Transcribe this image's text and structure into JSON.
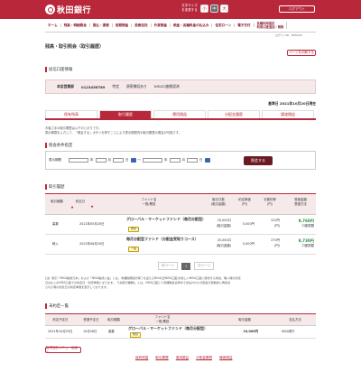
{
  "header": {
    "bank_name": "秋田銀行",
    "font_size_label": "文字サイズを変更する",
    "font_sizes": [
      "小",
      "中",
      "大"
    ],
    "logout_label": "ログアウト"
  },
  "nav": {
    "items": [
      "ホーム",
      "残高・明細照会",
      "振込・振替",
      "定期預金",
      "投資信託",
      "外貨預金",
      "税金・各種料金の払込み",
      "住宅ローン",
      "電子交付"
    ],
    "settings_label": "各種利用設定",
    "settings_sub": "利用口座追加・削除"
  },
  "user_id": "ログインID：RFR103",
  "page": {
    "title": "残高・取引照会（取引履歴）",
    "print_button": "ページを印刷する"
  },
  "section_titles": {
    "account": "投信口座情報",
    "filter": "照会条件指定",
    "history": "取引履歴",
    "orders": "未約定一覧"
  },
  "account": {
    "branch": "本店営業部",
    "number": "0123456789",
    "type": "特定",
    "withholding": "源泉徴収あり",
    "nisa": "NISA口座開設済"
  },
  "base_date": "基準日 2021年10月20日現在",
  "tabs": [
    "保有残高",
    "取引履歴",
    "運用損益",
    "分配金履歴",
    "譲渡損益"
  ],
  "note": {
    "line1": "お客さまの取引履歴は以下のとおりです。",
    "line2": "表示期間を入力して、「照会する」ボタンを押すことにより表示期間内の取引履歴の照会が可能です。"
  },
  "filter": {
    "label": "表示期間",
    "year": "年",
    "month": "月",
    "day": "日",
    "tilde": "～",
    "calendar": "カレンダー",
    "query_button": "照会する"
  },
  "history": {
    "headers": {
      "trade_type": "取引種類",
      "agreed_date": "約定日",
      "fund": "ファンド名",
      "fund_sub": "一般/累投",
      "amount": "取引口数",
      "amount_sub": "(取引金額)",
      "price": "約定単価",
      "price_sub": "(円)",
      "fee": "手数料等",
      "fee_sub": "(円)",
      "settlement": "受渡金額",
      "settlement_sub": "受渡方法",
      "sort_up": "▲",
      "sort_down": "▼"
    },
    "rows": [
      {
        "type": "募集",
        "date": "2021年05月20日",
        "fund": "グローバル・マーケットファンド（毎月分配型）",
        "category": "累投",
        "units": "20,000口",
        "units_sub": "(取引金額)",
        "price": "5,000円",
        "fee": "220円",
        "fee_sub": "(円)",
        "settle": "9,760円",
        "settle_method": "口座振替"
      },
      {
        "type": "積入",
        "date": "2021年06月20日",
        "fund": "毎月分配型ファンド（分配金受取りコース）",
        "category": "一般",
        "units": "25,000口",
        "units_sub": "(取引金額)",
        "price": "5,000円",
        "fee": "270円",
        "fee_sub": "(円)",
        "settle": "9,730円",
        "settle_method": "口座振替"
      }
    ]
  },
  "pager": {
    "prev": "前ページ",
    "current": "1",
    "next": "次ページ"
  },
  "footnote": {
    "line1": "(注）取引「NISA組成元本」および「NISA組成入金」とは、非課税期間が満了を迎えるNISA(旧NISA口座)を新しいNISA口座に移管する場合、購入時の約定",
    "line2": "日はもとのNISA口座での約定日・約定単価となります。「(お取引種類)」とは、NISA口座にて非課税投資枠内で支払われた分配金が自動的に再投資",
    "line3": "された時の約定日の約定単価を表示しております。"
  },
  "orders": {
    "headers": {
      "agreed": "約定予定日",
      "settle": "受渡予定日",
      "type": "取引種類",
      "fund": "ファンド名",
      "fund_sub": "一般/累投",
      "amount": "取引金額",
      "method": "支払方法"
    },
    "row": {
      "agreed": "2021年10月25日",
      "settle": "10月28日",
      "type": "募集",
      "fund": "グローバル・マーケットファンド（毎月分配型）",
      "category": "累投",
      "amount": "10,000円",
      "method": "NISA預り"
    }
  },
  "back_button": "投資信託メニュー画面へ",
  "bottom_nav": [
    "保有残高",
    "取引履歴",
    "運用損益",
    "分配金履歴",
    "譲渡損益"
  ],
  "colors": {
    "brand": "#b8283a",
    "light": "#f5e9ea",
    "gain": "#2b8a3e"
  }
}
